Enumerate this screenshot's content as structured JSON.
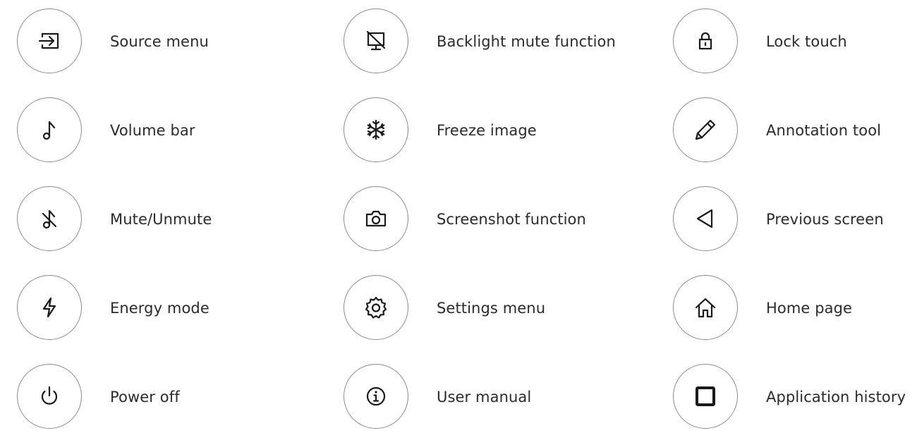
{
  "columns": [
    {
      "items": [
        {
          "label": "Source menu",
          "icon": "source-icon"
        },
        {
          "label": "Volume bar",
          "icon": "music-note-icon"
        },
        {
          "label": "Mute/Unmute",
          "icon": "music-note-muted-icon"
        },
        {
          "label": "Energy mode",
          "icon": "lightning-icon"
        },
        {
          "label": "Power off",
          "icon": "power-icon"
        }
      ]
    },
    {
      "items": [
        {
          "label": "Backlight mute function",
          "icon": "monitor-off-icon"
        },
        {
          "label": "Freeze image",
          "icon": "snowflake-icon"
        },
        {
          "label": "Screenshot function",
          "icon": "camera-icon"
        },
        {
          "label": "Settings menu",
          "icon": "gear-icon"
        },
        {
          "label": "User manual",
          "icon": "info-icon"
        }
      ]
    },
    {
      "items": [
        {
          "label": "Lock touch",
          "icon": "lock-icon"
        },
        {
          "label": "Annotation tool",
          "icon": "pencil-icon"
        },
        {
          "label": "Previous screen",
          "icon": "triangle-left-icon"
        },
        {
          "label": "Home page",
          "icon": "home-icon"
        },
        {
          "label": "Application history",
          "icon": "square-icon"
        }
      ]
    }
  ]
}
